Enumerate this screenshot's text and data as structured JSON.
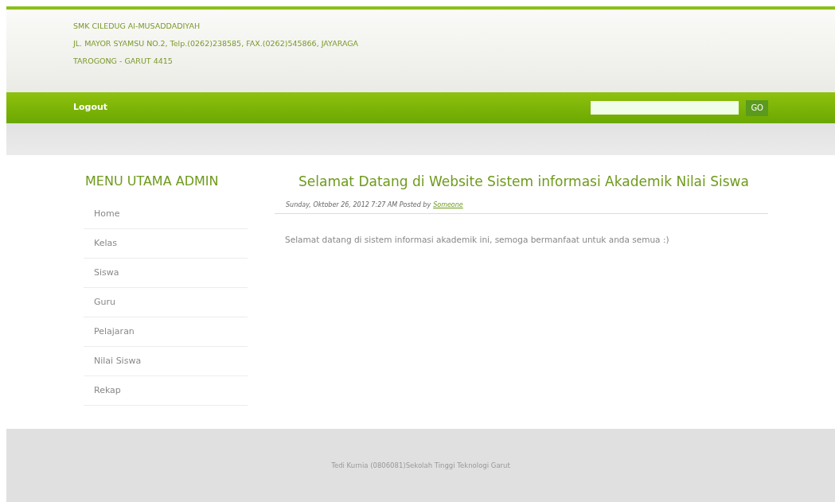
{
  "header": {
    "lines": [
      "SMK CILEDUG Al-MUSADDADIYAH",
      "JL. MAYOR SYAMSU NO.2, Telp.(0262)238585, FAX.(0262)545866, JAYARAGA",
      "TAROGONG - GARUT 4415"
    ]
  },
  "nav": {
    "links": [
      "Logout"
    ],
    "search": {
      "button": "GO"
    }
  },
  "sidebar": {
    "title": "MENU UTAMA ADMIN",
    "items": [
      "Home",
      "Kelas",
      "Siswa",
      "Guru",
      "Pelajaran",
      "Nilai Siswa",
      "Rekap"
    ]
  },
  "post": {
    "title": "Selamat Datang di Website Sistem informasi Akademik Nilai Siswa",
    "meta": "Sunday, Oktober 26, 2012 7:27 AM Posted by",
    "author": "Someone",
    "body": "Selamat datang di sistem informasi akademik ini, semoga bermanfaat untuk anda semua :)"
  },
  "footer": "Tedi Kurnia (0806081)Sekolah Tinggi Teknologi Garut"
}
